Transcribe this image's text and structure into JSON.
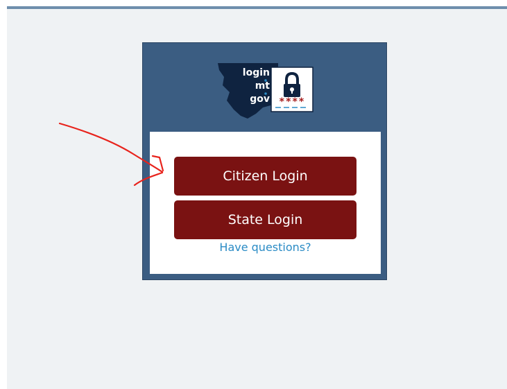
{
  "colors": {
    "background": "#eff2f4",
    "top_bar": "#6e8eac",
    "panel": "#3b5d82",
    "button": "#7a1212",
    "link": "#2a8bc5",
    "annotation": "#e8231c"
  },
  "logo": {
    "text_line1": "login",
    "text_line2": "mt",
    "text_line3": "gov",
    "stars": "****",
    "icons": [
      "montana-state-outline",
      "padlock-icon"
    ]
  },
  "login": {
    "citizen_label": "Citizen Login",
    "state_label": "State Login",
    "help_link": "Have questions?"
  },
  "annotation": {
    "icon": "red-arrow-pointing-right"
  }
}
